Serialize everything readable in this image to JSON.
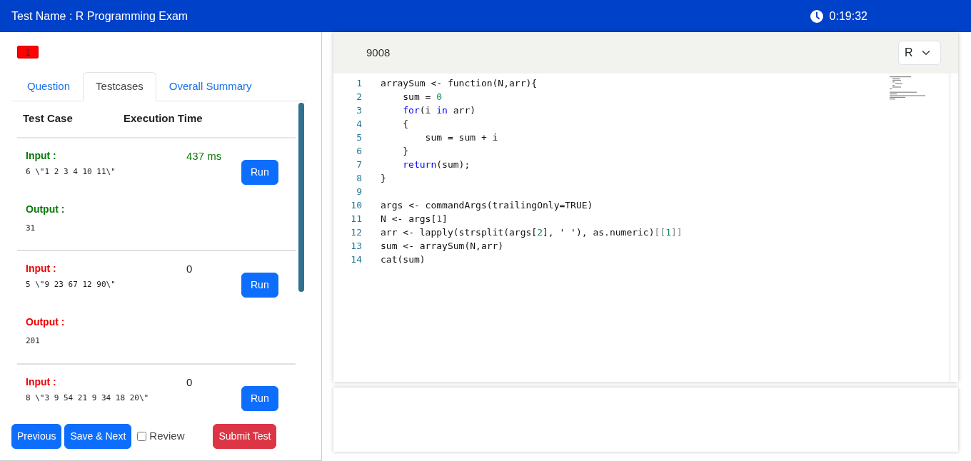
{
  "header": {
    "title": "Test Name : R Programming Exam",
    "timer": "0:19:32"
  },
  "question_badge": "1",
  "tabs": [
    {
      "label": "Question",
      "selected": false
    },
    {
      "label": "Testcases",
      "selected": true
    },
    {
      "label": "Overall Summary",
      "selected": false
    }
  ],
  "testcases": {
    "columns": [
      "Test Case",
      "Execution Time"
    ],
    "rows": [
      {
        "passed": true,
        "input_label": "Input :",
        "input": "6 \\\"1 2 3 4 10 11\\\"",
        "time": "437 ms",
        "run": "Run",
        "output_label": "Output :",
        "output": "31"
      },
      {
        "passed": false,
        "input_label": "Input :",
        "input": "5 \\\"9 23 67 12 90\\\"",
        "time": "0",
        "run": "Run",
        "output_label": "Output :",
        "output": "201"
      },
      {
        "passed": false,
        "input_label": "Input :",
        "input": "8 \\\"3 9 54 21 9 34 18 20\\\"",
        "time": "0",
        "run": "Run"
      }
    ]
  },
  "footer": {
    "previous": "Previous",
    "save_next": "Save & Next",
    "review": {
      "label": "Review",
      "checked": false
    },
    "submit": "Submit Test"
  },
  "editor": {
    "title": "9008",
    "language": "R",
    "lines": [
      {
        "number": "1",
        "tokens": [
          {
            "kind": "plain",
            "text": "arraySum <- function(N,arr){"
          }
        ],
        "children": [
          {
            "number": "2",
            "tokens": [
              {
                "kind": "plain",
                "text": "sum = "
              },
              {
                "kind": "number",
                "text": "0"
              }
            ]
          },
          {
            "number": "3",
            "tokens": [
              {
                "kind": "keyword",
                "text": "for"
              },
              {
                "kind": "plain",
                "text": "(i "
              },
              {
                "kind": "keyword",
                "text": "in"
              },
              {
                "kind": "plain",
                "text": " arr)"
              }
            ]
          },
          {
            "number": "4",
            "tokens": [
              {
                "kind": "plain",
                "text": "{"
              }
            ],
            "children": [
              {
                "number": "5",
                "tokens": [
                  {
                    "kind": "plain",
                    "text": "sum = sum + i"
                  }
                ]
              }
            ]
          },
          {
            "number": "6",
            "tokens": [
              {
                "kind": "plain",
                "text": "}"
              }
            ]
          },
          {
            "number": "7",
            "tokens": [
              {
                "kind": "keyword",
                "text": "return"
              },
              {
                "kind": "plain",
                "text": "(sum);"
              }
            ]
          }
        ]
      },
      {
        "number": "8",
        "tokens": [
          {
            "kind": "plain",
            "text": "}"
          }
        ]
      },
      {
        "number": "9"
      },
      {
        "number": "10",
        "tokens": [
          {
            "kind": "plain",
            "text": "args <- commandArgs(trailingOnly=TRUE)"
          }
        ]
      },
      {
        "number": "11",
        "tokens": [
          {
            "kind": "plain",
            "text": "N <- args["
          },
          {
            "kind": "number",
            "text": "1"
          },
          {
            "kind": "plain",
            "text": "]"
          }
        ]
      },
      {
        "number": "12",
        "tokens": [
          {
            "kind": "plain",
            "text": "arr <- lapply(strsplit(args["
          },
          {
            "kind": "number",
            "text": "2"
          },
          {
            "kind": "plain",
            "text": "], ' '), as.numeric)"
          },
          {
            "kind": "muted",
            "text": "[["
          },
          {
            "kind": "number",
            "text": "1"
          },
          {
            "kind": "muted",
            "text": "]]"
          }
        ]
      },
      {
        "number": "13",
        "tokens": [
          {
            "kind": "plain",
            "text": "sum <- arraySum(N,arr)"
          }
        ]
      },
      {
        "number": "14",
        "tokens": [
          {
            "kind": "plain",
            "text": "cat(sum)"
          }
        ]
      }
    ]
  }
}
